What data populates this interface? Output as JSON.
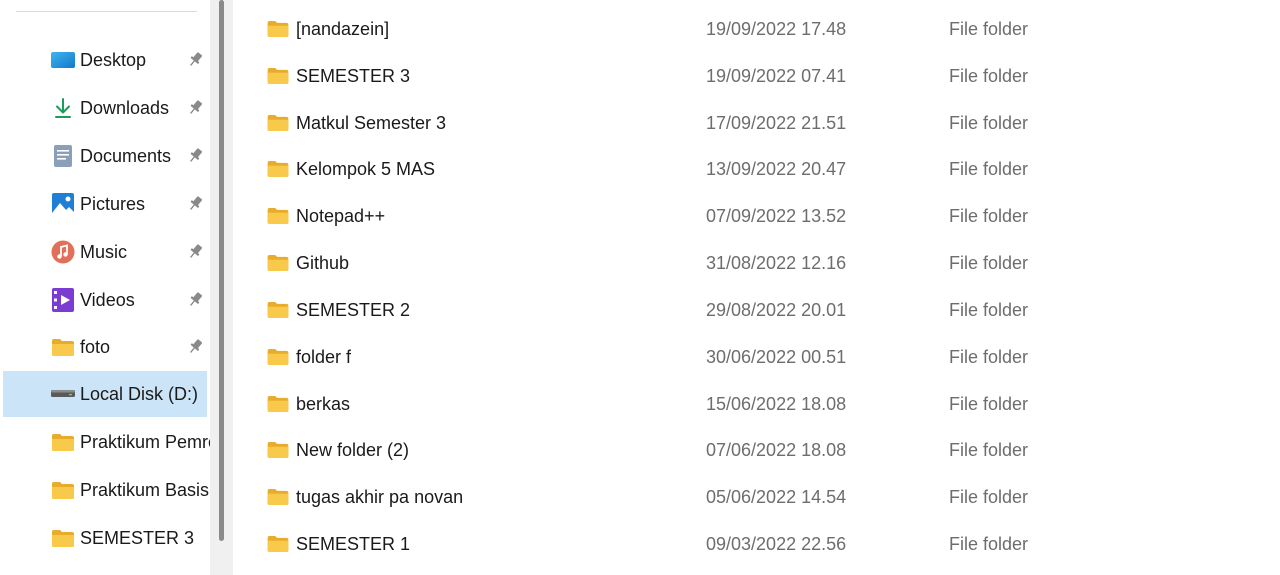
{
  "sidebar": {
    "items": [
      {
        "label": "Desktop",
        "icon": "desktop-icon",
        "pinned": true
      },
      {
        "label": "Downloads",
        "icon": "download-icon",
        "pinned": true
      },
      {
        "label": "Documents",
        "icon": "documents-icon",
        "pinned": true
      },
      {
        "label": "Pictures",
        "icon": "pictures-icon",
        "pinned": true
      },
      {
        "label": "Music",
        "icon": "music-icon",
        "pinned": true
      },
      {
        "label": "Videos",
        "icon": "videos-icon",
        "pinned": true
      },
      {
        "label": "foto",
        "icon": "folder-icon",
        "pinned": true
      },
      {
        "label": "Local Disk (D:)",
        "icon": "drive-icon",
        "pinned": false,
        "selected": true
      },
      {
        "label": "Praktikum Pemro",
        "icon": "folder-icon",
        "pinned": false
      },
      {
        "label": "Praktikum Basis",
        "icon": "folder-icon",
        "pinned": false
      },
      {
        "label": "SEMESTER 3",
        "icon": "folder-icon",
        "pinned": false
      }
    ]
  },
  "files": [
    {
      "name": "[nandazein]",
      "date": "19/09/2022 17.48",
      "type": "File folder"
    },
    {
      "name": "SEMESTER 3",
      "date": "19/09/2022 07.41",
      "type": "File folder"
    },
    {
      "name": "Matkul Semester 3",
      "date": "17/09/2022 21.51",
      "type": "File folder"
    },
    {
      "name": "Kelompok 5 MAS",
      "date": "13/09/2022 20.47",
      "type": "File folder"
    },
    {
      "name": "Notepad++",
      "date": "07/09/2022 13.52",
      "type": "File folder"
    },
    {
      "name": "Github",
      "date": "31/08/2022 12.16",
      "type": "File folder"
    },
    {
      "name": "SEMESTER 2",
      "date": "29/08/2022 20.01",
      "type": "File folder"
    },
    {
      "name": "folder f",
      "date": "30/06/2022 00.51",
      "type": "File folder"
    },
    {
      "name": "berkas",
      "date": "15/06/2022 18.08",
      "type": "File folder"
    },
    {
      "name": "New folder (2)",
      "date": "07/06/2022 18.08",
      "type": "File folder"
    },
    {
      "name": "tugas akhir pa novan",
      "date": "05/06/2022 14.54",
      "type": "File folder"
    },
    {
      "name": "SEMESTER 1",
      "date": "09/03/2022 22.56",
      "type": "File folder"
    }
  ],
  "colors": {
    "selection": "#cce4f7",
    "folder": "#f8c94a",
    "secondary_text": "#6d6d6d"
  }
}
